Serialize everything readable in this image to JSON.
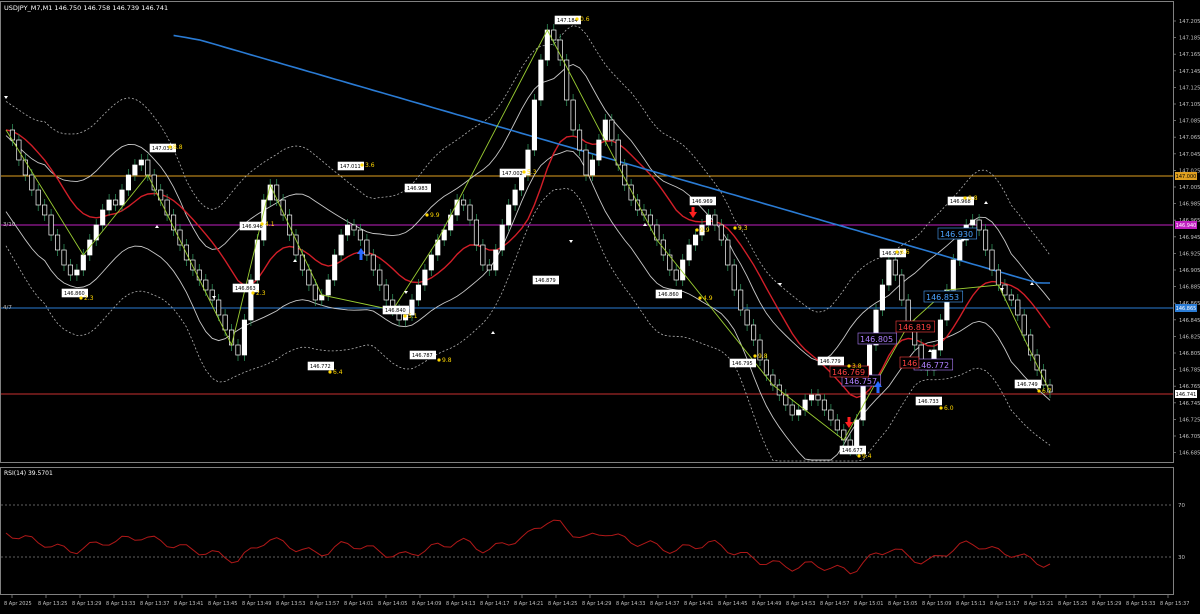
{
  "window": {
    "title": "USDJPY_M7,M1 146.750 146.758 146.739 146.741",
    "rsi_title": "RSI(14) 39.5701"
  },
  "price_axis": {
    "labels": [
      "147.205",
      "147.185",
      "147.165",
      "147.145",
      "147.125",
      "147.105",
      "147.085",
      "147.065",
      "147.045",
      "147.025",
      "147.005",
      "146.985",
      "146.965",
      "146.945",
      "146.925",
      "146.905",
      "146.885",
      "146.865",
      "146.845",
      "146.825",
      "146.805",
      "146.785",
      "146.765",
      "146.745",
      "146.725",
      "146.705",
      "146.685"
    ],
    "current_price": "146.741",
    "line_labels": {
      "orange": "147.000",
      "magenta": "146.940",
      "blue": "146.865"
    },
    "left_tags": {
      "magenta": "3/10",
      "blue": "4/7"
    }
  },
  "rsi_axis": {
    "upper": "70",
    "lower": "30"
  },
  "time_axis": {
    "labels": [
      "8 Apr 2025",
      "8 Apr 13:25",
      "8 Apr 13:29",
      "8 Apr 13:33",
      "8 Apr 13:37",
      "8 Apr 13:41",
      "8 Apr 13:45",
      "8 Apr 13:49",
      "8 Apr 13:53",
      "8 Apr 13:57",
      "8 Apr 14:01",
      "8 Apr 14:05",
      "8 Apr 14:09",
      "8 Apr 14:13",
      "8 Apr 14:17",
      "8 Apr 14:21",
      "8 Apr 14:25",
      "8 Apr 14:29",
      "8 Apr 14:33",
      "8 Apr 14:37",
      "8 Apr 14:41",
      "8 Apr 14:45",
      "8 Apr 14:49",
      "8 Apr 14:53",
      "8 Apr 14:57",
      "8 Apr 15:01",
      "8 Apr 15:05",
      "8 Apr 15:09",
      "8 Apr 15:13",
      "8 Apr 15:17",
      "8 Apr 15:21",
      "8 Apr 15:25",
      "8 Apr 15:29",
      "8 Apr 15:33",
      "8 Apr 15:37"
    ]
  },
  "price_tags": [
    {
      "text": "146.860",
      "kind": "white"
    },
    {
      "text": "147.033",
      "kind": "white"
    },
    {
      "text": "146.946",
      "kind": "white"
    },
    {
      "text": "146.863",
      "kind": "white"
    },
    {
      "text": "146.772",
      "kind": "white"
    },
    {
      "text": "147.011",
      "kind": "white"
    },
    {
      "text": "146.983",
      "kind": "white"
    },
    {
      "text": "146.840",
      "kind": "white"
    },
    {
      "text": "146.787",
      "kind": "white"
    },
    {
      "text": "147.002",
      "kind": "white"
    },
    {
      "text": "146.879",
      "kind": "white"
    },
    {
      "text": "147.184",
      "kind": "white"
    },
    {
      "text": "146.860",
      "kind": "white"
    },
    {
      "text": "146.969",
      "kind": "white"
    },
    {
      "text": "146.795",
      "kind": "white"
    },
    {
      "text": "146.779",
      "kind": "white"
    },
    {
      "text": "146.677",
      "kind": "white"
    },
    {
      "text": "146.907",
      "kind": "white"
    },
    {
      "text": "146.968",
      "kind": "white"
    },
    {
      "text": "146.733",
      "kind": "white"
    },
    {
      "text": "146.749",
      "kind": "white"
    },
    {
      "text": "146.930",
      "kind": "blue"
    },
    {
      "text": "146.853",
      "kind": "blue"
    },
    {
      "text": "146.805",
      "kind": "purple"
    },
    {
      "text": "146.772",
      "kind": "purple"
    },
    {
      "text": "146.757",
      "kind": "purple"
    },
    {
      "text": "146.819",
      "kind": "red"
    },
    {
      "text": "146.769",
      "kind": "red"
    },
    {
      "text": "146",
      "kind": "red"
    }
  ],
  "swing_labels": [
    "2.3",
    "8.8",
    "3.6",
    "9.9",
    "5.3",
    "0.6",
    "2.3",
    "5.1",
    "4.1",
    "9.8",
    "6.4",
    "9.9",
    "9.3",
    "4.9",
    "9.8",
    "9.4",
    "8.6",
    "6.0",
    "8.8",
    "3.8",
    "6.7"
  ],
  "colors": {
    "background": "#000000",
    "bull_candle": "#ffffff",
    "bear_candle": "#000000",
    "candle_outline": "#ffffff",
    "ma_red": "#d21e28",
    "ma_blue": "#2a7bd4",
    "band": "#c8c8c8",
    "zigzag": "#9acd32",
    "orange_line": "#e0a020",
    "magenta_line": "#c020c0",
    "blue_line": "#2a7bd4",
    "rsi_line": "#b01818"
  }
}
